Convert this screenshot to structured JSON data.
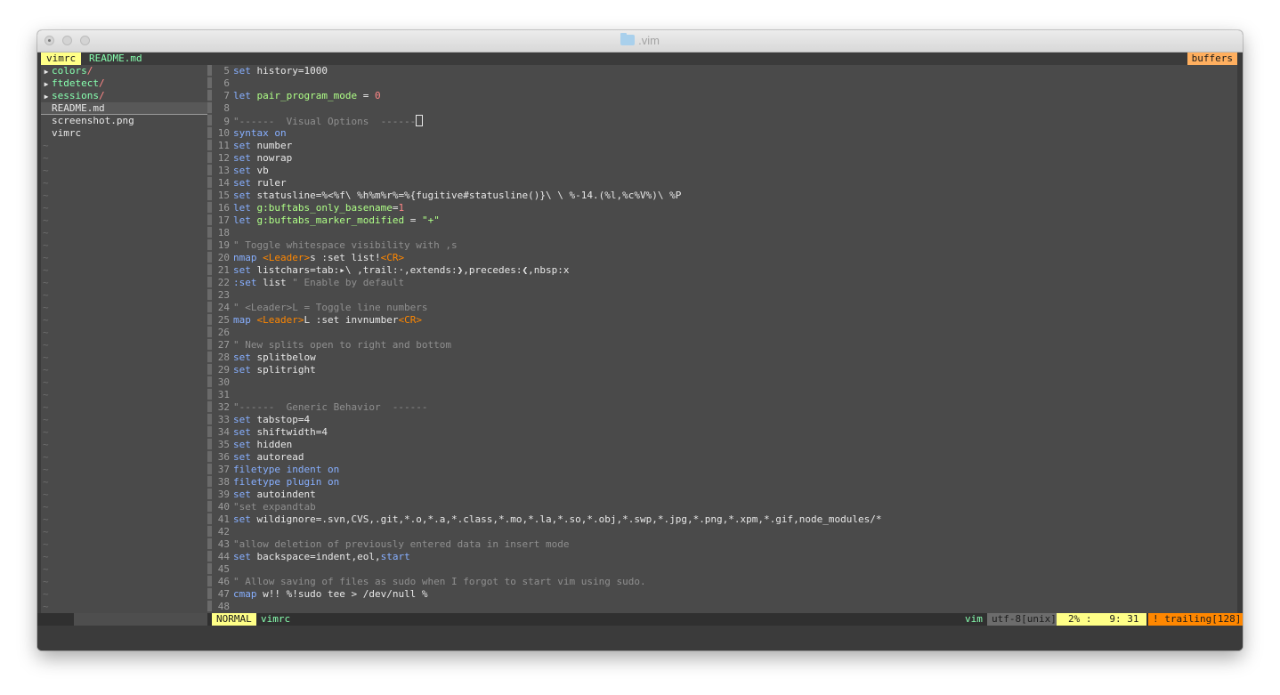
{
  "window": {
    "title": ".vim"
  },
  "tabline": {
    "active_tab": "vimrc",
    "other_tab": "README.md",
    "buffers_label": "buffers"
  },
  "tree": {
    "dirs": [
      "colors",
      "ftdetect",
      "sessions"
    ],
    "dir_suffix": "/",
    "selected_file": "README.md",
    "files": [
      "screenshot.png",
      "vimrc"
    ],
    "tilde": "~"
  },
  "editor": {
    "lines": [
      {
        "n": "5",
        "tokens": [
          {
            "t": "set",
            "c": "kw"
          },
          {
            "t": " history=1000"
          }
        ]
      },
      {
        "n": "6",
        "tokens": []
      },
      {
        "n": "7",
        "tokens": [
          {
            "t": "let",
            "c": "kw"
          },
          {
            "t": " "
          },
          {
            "t": "pair_program_mode",
            "c": "var"
          },
          {
            "t": " = "
          },
          {
            "t": "0",
            "c": "num"
          }
        ]
      },
      {
        "n": "8",
        "tokens": []
      },
      {
        "n": "9",
        "tokens": [
          {
            "t": "\"------  Visual Options  ------",
            "c": "cm"
          }
        ],
        "cursor": true
      },
      {
        "n": "10",
        "tokens": [
          {
            "t": "syntax",
            "c": "kw"
          },
          {
            "t": " "
          },
          {
            "t": "on",
            "c": "kw"
          }
        ]
      },
      {
        "n": "11",
        "tokens": [
          {
            "t": "set",
            "c": "kw"
          },
          {
            "t": " number"
          }
        ]
      },
      {
        "n": "12",
        "tokens": [
          {
            "t": "set",
            "c": "kw"
          },
          {
            "t": " nowrap"
          }
        ]
      },
      {
        "n": "13",
        "tokens": [
          {
            "t": "set",
            "c": "kw"
          },
          {
            "t": " vb"
          }
        ]
      },
      {
        "n": "14",
        "tokens": [
          {
            "t": "set",
            "c": "kw"
          },
          {
            "t": " ruler"
          }
        ]
      },
      {
        "n": "15",
        "tokens": [
          {
            "t": "set",
            "c": "kw"
          },
          {
            "t": " statusline=%<%f\\ %h%m%r%=%{fugitive#statusline()}\\ \\ %-14.(%l,%c%V%)\\ %P"
          }
        ]
      },
      {
        "n": "16",
        "tokens": [
          {
            "t": "let",
            "c": "kw"
          },
          {
            "t": " "
          },
          {
            "t": "g:buftabs_only_basename",
            "c": "var"
          },
          {
            "t": "="
          },
          {
            "t": "1",
            "c": "num"
          }
        ]
      },
      {
        "n": "17",
        "tokens": [
          {
            "t": "let",
            "c": "kw"
          },
          {
            "t": " "
          },
          {
            "t": "g:buftabs_marker_modified",
            "c": "var"
          },
          {
            "t": " = "
          },
          {
            "t": "\"+\"",
            "c": "str"
          }
        ]
      },
      {
        "n": "18",
        "tokens": []
      },
      {
        "n": "19",
        "tokens": [
          {
            "t": "\" Toggle whitespace visibility with ,s",
            "c": "cm"
          }
        ]
      },
      {
        "n": "20",
        "tokens": [
          {
            "t": "nmap",
            "c": "kw"
          },
          {
            "t": " "
          },
          {
            "t": "<Leader>",
            "c": "key"
          },
          {
            "t": "s :set list!"
          },
          {
            "t": "<CR>",
            "c": "key"
          }
        ]
      },
      {
        "n": "21",
        "tokens": [
          {
            "t": "set",
            "c": "kw"
          },
          {
            "t": " listchars=tab:▸\\ ,trail:·,extends:❯,precedes:❮,nbsp:x"
          }
        ]
      },
      {
        "n": "22",
        "tokens": [
          {
            "t": ":set",
            "c": "kw"
          },
          {
            "t": " list "
          },
          {
            "t": "\" Enable by default",
            "c": "cm"
          }
        ]
      },
      {
        "n": "23",
        "tokens": []
      },
      {
        "n": "24",
        "tokens": [
          {
            "t": "\" <Leader>L = Toggle line numbers",
            "c": "cm"
          }
        ]
      },
      {
        "n": "25",
        "tokens": [
          {
            "t": "map",
            "c": "kw"
          },
          {
            "t": " "
          },
          {
            "t": "<Leader>",
            "c": "key"
          },
          {
            "t": "L :set invnumber"
          },
          {
            "t": "<CR>",
            "c": "key"
          }
        ]
      },
      {
        "n": "26",
        "tokens": []
      },
      {
        "n": "27",
        "tokens": [
          {
            "t": "\" New splits open to right and bottom",
            "c": "cm"
          }
        ]
      },
      {
        "n": "28",
        "tokens": [
          {
            "t": "set",
            "c": "kw"
          },
          {
            "t": " splitbelow"
          }
        ]
      },
      {
        "n": "29",
        "tokens": [
          {
            "t": "set",
            "c": "kw"
          },
          {
            "t": " splitright"
          }
        ]
      },
      {
        "n": "30",
        "tokens": []
      },
      {
        "n": "31",
        "tokens": []
      },
      {
        "n": "32",
        "tokens": [
          {
            "t": "\"------  Generic Behavior  ------",
            "c": "cm"
          }
        ]
      },
      {
        "n": "33",
        "tokens": [
          {
            "t": "set",
            "c": "kw"
          },
          {
            "t": " tabstop=4"
          }
        ]
      },
      {
        "n": "34",
        "tokens": [
          {
            "t": "set",
            "c": "kw"
          },
          {
            "t": " shiftwidth=4"
          }
        ]
      },
      {
        "n": "35",
        "tokens": [
          {
            "t": "set",
            "c": "kw"
          },
          {
            "t": " hidden"
          }
        ]
      },
      {
        "n": "36",
        "tokens": [
          {
            "t": "set",
            "c": "kw"
          },
          {
            "t": " autoread"
          }
        ]
      },
      {
        "n": "37",
        "tokens": [
          {
            "t": "filetype",
            "c": "kw"
          },
          {
            "t": " "
          },
          {
            "t": "indent",
            "c": "kw"
          },
          {
            "t": " "
          },
          {
            "t": "on",
            "c": "kw"
          }
        ]
      },
      {
        "n": "38",
        "tokens": [
          {
            "t": "filetype",
            "c": "kw"
          },
          {
            "t": " "
          },
          {
            "t": "plugin",
            "c": "kw"
          },
          {
            "t": " "
          },
          {
            "t": "on",
            "c": "kw"
          }
        ]
      },
      {
        "n": "39",
        "tokens": [
          {
            "t": "set",
            "c": "kw"
          },
          {
            "t": " autoindent"
          }
        ]
      },
      {
        "n": "40",
        "tokens": [
          {
            "t": "\"set expandtab",
            "c": "cm"
          }
        ]
      },
      {
        "n": "41",
        "tokens": [
          {
            "t": "set",
            "c": "kw"
          },
          {
            "t": " wildignore=.svn,CVS,.git,*.o,*.a,*.class,*.mo,*.la,*.so,*.obj,*.swp,*.jpg,*.png,*.xpm,*.gif,node_modules/*"
          }
        ]
      },
      {
        "n": "42",
        "tokens": []
      },
      {
        "n": "43",
        "tokens": [
          {
            "t": "\"allow deletion of previously entered data in insert mode",
            "c": "cm"
          }
        ]
      },
      {
        "n": "44",
        "tokens": [
          {
            "t": "set",
            "c": "kw"
          },
          {
            "t": " backspace=indent,eol,"
          },
          {
            "t": "start",
            "c": "kw"
          }
        ]
      },
      {
        "n": "45",
        "tokens": []
      },
      {
        "n": "46",
        "tokens": [
          {
            "t": "\" Allow saving of files as sudo when I forgot to start vim using sudo.",
            "c": "cm"
          }
        ]
      },
      {
        "n": "47",
        "tokens": [
          {
            "t": "cmap",
            "c": "kw"
          },
          {
            "t": " w!! %!sudo tee > /dev/null %"
          }
        ]
      },
      {
        "n": "48",
        "tokens": []
      }
    ]
  },
  "statusline": {
    "mode": "NORMAL",
    "filename": "vimrc",
    "filetype": "vim",
    "encoding": "utf-8[unix]",
    "position": "2% :   9: 31",
    "warning": "! trailing[128]"
  }
}
